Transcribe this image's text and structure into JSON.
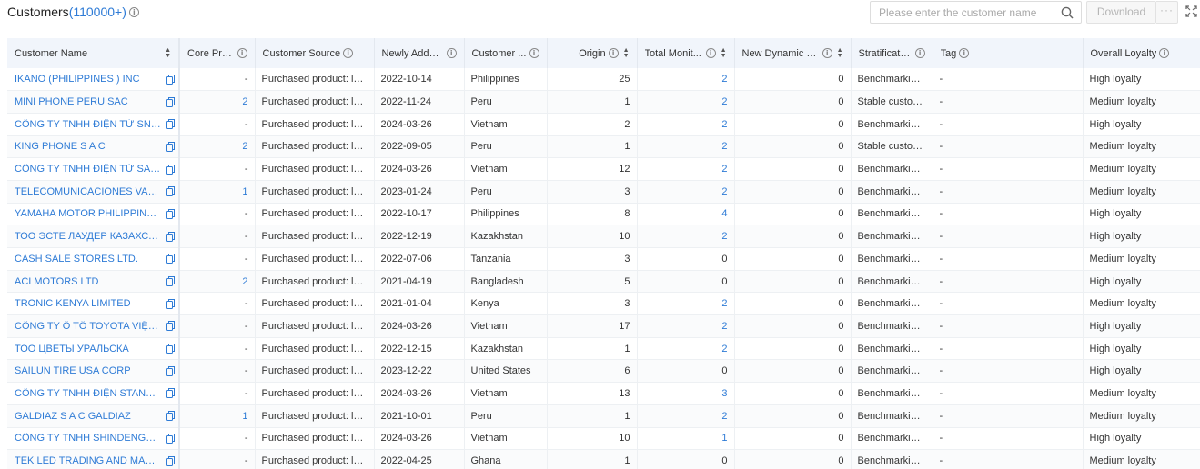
{
  "header": {
    "title": "Customers",
    "count": "(110000+)"
  },
  "search": {
    "placeholder": "Please enter the customer name"
  },
  "toolbar": {
    "download_label": "Download",
    "more_label": "···"
  },
  "columns": [
    "Customer Name",
    "Core Pro...",
    "Customer Source",
    "Newly Added...",
    "Customer ...",
    "Origin",
    "Total Monit...",
    "New Dynamic N...",
    "Stratification",
    "Tag",
    "Overall Loyalty"
  ],
  "rows": [
    {
      "name": "IKANO (PHILIPPINES ) INC",
      "core": "-",
      "source": "Purchased product: led li...",
      "added": "2022-10-14",
      "country": "Philippines",
      "origin": "25",
      "total": "2",
      "dynamic": "0",
      "strat": "Benchmarking ...",
      "tag": "-",
      "loyalty": "High loyalty"
    },
    {
      "name": "MINI PHONE PERU SAC",
      "core": "2",
      "source": "Purchased product: led li...",
      "added": "2022-11-24",
      "country": "Peru",
      "origin": "1",
      "total": "2",
      "dynamic": "0",
      "strat": "Stable custome...",
      "tag": "-",
      "loyalty": "Medium loyalty"
    },
    {
      "name": "CÔNG TY TNHH ĐIỆN TỬ SNC VIỆ...",
      "core": "-",
      "source": "Purchased product: led li...",
      "added": "2024-03-26",
      "country": "Vietnam",
      "origin": "2",
      "total": "2",
      "dynamic": "0",
      "strat": "Benchmarking ...",
      "tag": "-",
      "loyalty": "High loyalty"
    },
    {
      "name": "KING PHONE S A C",
      "core": "2",
      "source": "Purchased product: led li...",
      "added": "2022-09-05",
      "country": "Peru",
      "origin": "1",
      "total": "2",
      "dynamic": "0",
      "strat": "Stable custome...",
      "tag": "-",
      "loyalty": "Medium loyalty"
    },
    {
      "name": "CÔNG TY TNHH ĐIỆN TỬ SAMSU...",
      "core": "-",
      "source": "Purchased product: led li...",
      "added": "2024-03-26",
      "country": "Vietnam",
      "origin": "12",
      "total": "2",
      "dynamic": "0",
      "strat": "Benchmarking ...",
      "tag": "-",
      "loyalty": "Medium loyalty"
    },
    {
      "name": "TELECOMUNICACIONES VALLE S ...",
      "core": "1",
      "source": "Purchased product: led li...",
      "added": "2023-01-24",
      "country": "Peru",
      "origin": "3",
      "total": "2",
      "dynamic": "0",
      "strat": "Benchmarking ...",
      "tag": "-",
      "loyalty": "Medium loyalty"
    },
    {
      "name": "YAMAHA MOTOR PHILIPPINES INC.",
      "core": "-",
      "source": "Purchased product: led li...",
      "added": "2022-10-17",
      "country": "Philippines",
      "origin": "8",
      "total": "4",
      "dynamic": "0",
      "strat": "Benchmarking ...",
      "tag": "-",
      "loyalty": "High loyalty"
    },
    {
      "name": "ТОО ЭСТЕ ЛАУДЕР КАЗАХСТАН",
      "core": "-",
      "source": "Purchased product: led li...",
      "added": "2022-12-19",
      "country": "Kazakhstan",
      "origin": "10",
      "total": "2",
      "dynamic": "0",
      "strat": "Benchmarking ...",
      "tag": "-",
      "loyalty": "High loyalty"
    },
    {
      "name": "CASH SALE STORES LTD.",
      "core": "-",
      "source": "Purchased product: led li...",
      "added": "2022-07-06",
      "country": "Tanzania",
      "origin": "3",
      "total": "0",
      "dynamic": "0",
      "strat": "Benchmarking ...",
      "tag": "-",
      "loyalty": "Medium loyalty"
    },
    {
      "name": "ACI MOTORS LTD",
      "core": "2",
      "source": "Purchased product: led li...",
      "added": "2021-04-19",
      "country": "Bangladesh",
      "origin": "5",
      "total": "0",
      "dynamic": "0",
      "strat": "Benchmarking ...",
      "tag": "-",
      "loyalty": "High loyalty"
    },
    {
      "name": "TRONIC KENYA LIMITED",
      "core": "-",
      "source": "Purchased product: led li...",
      "added": "2021-01-04",
      "country": "Kenya",
      "origin": "3",
      "total": "2",
      "dynamic": "0",
      "strat": "Benchmarking ...",
      "tag": "-",
      "loyalty": "Medium loyalty"
    },
    {
      "name": "CÔNG TY Ô TÔ TOYOTA VIỆT NAM",
      "core": "-",
      "source": "Purchased product: led li...",
      "added": "2024-03-26",
      "country": "Vietnam",
      "origin": "17",
      "total": "2",
      "dynamic": "0",
      "strat": "Benchmarking ...",
      "tag": "-",
      "loyalty": "High loyalty"
    },
    {
      "name": "ТОО ЦВЕТЫ УРАЛЬСКА",
      "core": "-",
      "source": "Purchased product: led li...",
      "added": "2022-12-15",
      "country": "Kazakhstan",
      "origin": "1",
      "total": "2",
      "dynamic": "0",
      "strat": "Benchmarking ...",
      "tag": "-",
      "loyalty": "High loyalty"
    },
    {
      "name": "SAILUN TIRE USA CORP",
      "core": "-",
      "source": "Purchased product: led li...",
      "added": "2023-12-22",
      "country": "United States",
      "origin": "6",
      "total": "0",
      "dynamic": "0",
      "strat": "Benchmarking ...",
      "tag": "-",
      "loyalty": "High loyalty"
    },
    {
      "name": "CÔNG TY TNHH ĐIỆN STANLEY VI...",
      "core": "-",
      "source": "Purchased product: led li...",
      "added": "2024-03-26",
      "country": "Vietnam",
      "origin": "13",
      "total": "3",
      "dynamic": "0",
      "strat": "Benchmarking ...",
      "tag": "-",
      "loyalty": "Medium loyalty"
    },
    {
      "name": "GALDIAZ S A C GALDIAZ",
      "core": "1",
      "source": "Purchased product: led li...",
      "added": "2021-10-01",
      "country": "Peru",
      "origin": "1",
      "total": "2",
      "dynamic": "0",
      "strat": "Benchmarking ...",
      "tag": "-",
      "loyalty": "Medium loyalty"
    },
    {
      "name": "CÔNG TY TNHH SHINDENGEN VIỆ...",
      "core": "-",
      "source": "Purchased product: led li...",
      "added": "2024-03-26",
      "country": "Vietnam",
      "origin": "10",
      "total": "1",
      "dynamic": "0",
      "strat": "Benchmarking ...",
      "tag": "-",
      "loyalty": "High loyalty"
    },
    {
      "name": "TEK LED TRADING AND MANUFAC...",
      "core": "-",
      "source": "Purchased product: led li...",
      "added": "2022-04-25",
      "country": "Ghana",
      "origin": "1",
      "total": "0",
      "dynamic": "0",
      "strat": "Benchmarking ...",
      "tag": "-",
      "loyalty": "Medium loyalty"
    }
  ],
  "colors": {
    "link": "#2e7bd6",
    "header_bg": "#f1f5fb"
  }
}
